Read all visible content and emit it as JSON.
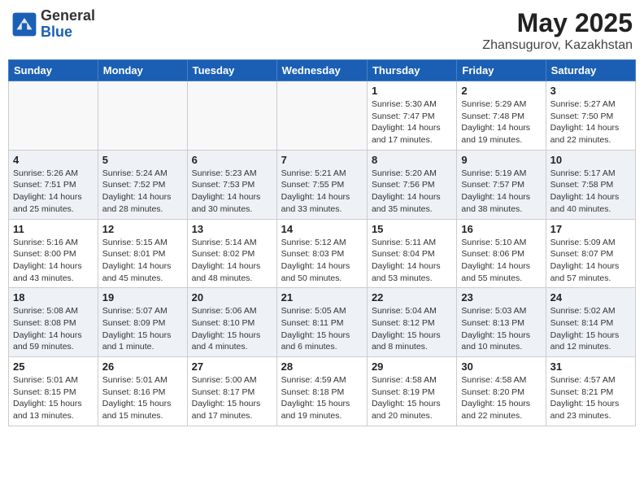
{
  "header": {
    "logo_general": "General",
    "logo_blue": "Blue",
    "month_title": "May 2025",
    "location": "Zhansugurov, Kazakhstan"
  },
  "days_of_week": [
    "Sunday",
    "Monday",
    "Tuesday",
    "Wednesday",
    "Thursday",
    "Friday",
    "Saturday"
  ],
  "weeks": [
    [
      {
        "day": "",
        "empty": true
      },
      {
        "day": "",
        "empty": true
      },
      {
        "day": "",
        "empty": true
      },
      {
        "day": "",
        "empty": true
      },
      {
        "day": "1",
        "sunrise": "5:30 AM",
        "sunset": "7:47 PM",
        "daylight": "14 hours and 17 minutes."
      },
      {
        "day": "2",
        "sunrise": "5:29 AM",
        "sunset": "7:48 PM",
        "daylight": "14 hours and 19 minutes."
      },
      {
        "day": "3",
        "sunrise": "5:27 AM",
        "sunset": "7:50 PM",
        "daylight": "14 hours and 22 minutes."
      }
    ],
    [
      {
        "day": "4",
        "sunrise": "5:26 AM",
        "sunset": "7:51 PM",
        "daylight": "14 hours and 25 minutes."
      },
      {
        "day": "5",
        "sunrise": "5:24 AM",
        "sunset": "7:52 PM",
        "daylight": "14 hours and 28 minutes."
      },
      {
        "day": "6",
        "sunrise": "5:23 AM",
        "sunset": "7:53 PM",
        "daylight": "14 hours and 30 minutes."
      },
      {
        "day": "7",
        "sunrise": "5:21 AM",
        "sunset": "7:55 PM",
        "daylight": "14 hours and 33 minutes."
      },
      {
        "day": "8",
        "sunrise": "5:20 AM",
        "sunset": "7:56 PM",
        "daylight": "14 hours and 35 minutes."
      },
      {
        "day": "9",
        "sunrise": "5:19 AM",
        "sunset": "7:57 PM",
        "daylight": "14 hours and 38 minutes."
      },
      {
        "day": "10",
        "sunrise": "5:17 AM",
        "sunset": "7:58 PM",
        "daylight": "14 hours and 40 minutes."
      }
    ],
    [
      {
        "day": "11",
        "sunrise": "5:16 AM",
        "sunset": "8:00 PM",
        "daylight": "14 hours and 43 minutes."
      },
      {
        "day": "12",
        "sunrise": "5:15 AM",
        "sunset": "8:01 PM",
        "daylight": "14 hours and 45 minutes."
      },
      {
        "day": "13",
        "sunrise": "5:14 AM",
        "sunset": "8:02 PM",
        "daylight": "14 hours and 48 minutes."
      },
      {
        "day": "14",
        "sunrise": "5:12 AM",
        "sunset": "8:03 PM",
        "daylight": "14 hours and 50 minutes."
      },
      {
        "day": "15",
        "sunrise": "5:11 AM",
        "sunset": "8:04 PM",
        "daylight": "14 hours and 53 minutes."
      },
      {
        "day": "16",
        "sunrise": "5:10 AM",
        "sunset": "8:06 PM",
        "daylight": "14 hours and 55 minutes."
      },
      {
        "day": "17",
        "sunrise": "5:09 AM",
        "sunset": "8:07 PM",
        "daylight": "14 hours and 57 minutes."
      }
    ],
    [
      {
        "day": "18",
        "sunrise": "5:08 AM",
        "sunset": "8:08 PM",
        "daylight": "14 hours and 59 minutes."
      },
      {
        "day": "19",
        "sunrise": "5:07 AM",
        "sunset": "8:09 PM",
        "daylight": "15 hours and 1 minute."
      },
      {
        "day": "20",
        "sunrise": "5:06 AM",
        "sunset": "8:10 PM",
        "daylight": "15 hours and 4 minutes."
      },
      {
        "day": "21",
        "sunrise": "5:05 AM",
        "sunset": "8:11 PM",
        "daylight": "15 hours and 6 minutes."
      },
      {
        "day": "22",
        "sunrise": "5:04 AM",
        "sunset": "8:12 PM",
        "daylight": "15 hours and 8 minutes."
      },
      {
        "day": "23",
        "sunrise": "5:03 AM",
        "sunset": "8:13 PM",
        "daylight": "15 hours and 10 minutes."
      },
      {
        "day": "24",
        "sunrise": "5:02 AM",
        "sunset": "8:14 PM",
        "daylight": "15 hours and 12 minutes."
      }
    ],
    [
      {
        "day": "25",
        "sunrise": "5:01 AM",
        "sunset": "8:15 PM",
        "daylight": "15 hours and 13 minutes."
      },
      {
        "day": "26",
        "sunrise": "5:01 AM",
        "sunset": "8:16 PM",
        "daylight": "15 hours and 15 minutes."
      },
      {
        "day": "27",
        "sunrise": "5:00 AM",
        "sunset": "8:17 PM",
        "daylight": "15 hours and 17 minutes."
      },
      {
        "day": "28",
        "sunrise": "4:59 AM",
        "sunset": "8:18 PM",
        "daylight": "15 hours and 19 minutes."
      },
      {
        "day": "29",
        "sunrise": "4:58 AM",
        "sunset": "8:19 PM",
        "daylight": "15 hours and 20 minutes."
      },
      {
        "day": "30",
        "sunrise": "4:58 AM",
        "sunset": "8:20 PM",
        "daylight": "15 hours and 22 minutes."
      },
      {
        "day": "31",
        "sunrise": "4:57 AM",
        "sunset": "8:21 PM",
        "daylight": "15 hours and 23 minutes."
      }
    ]
  ]
}
